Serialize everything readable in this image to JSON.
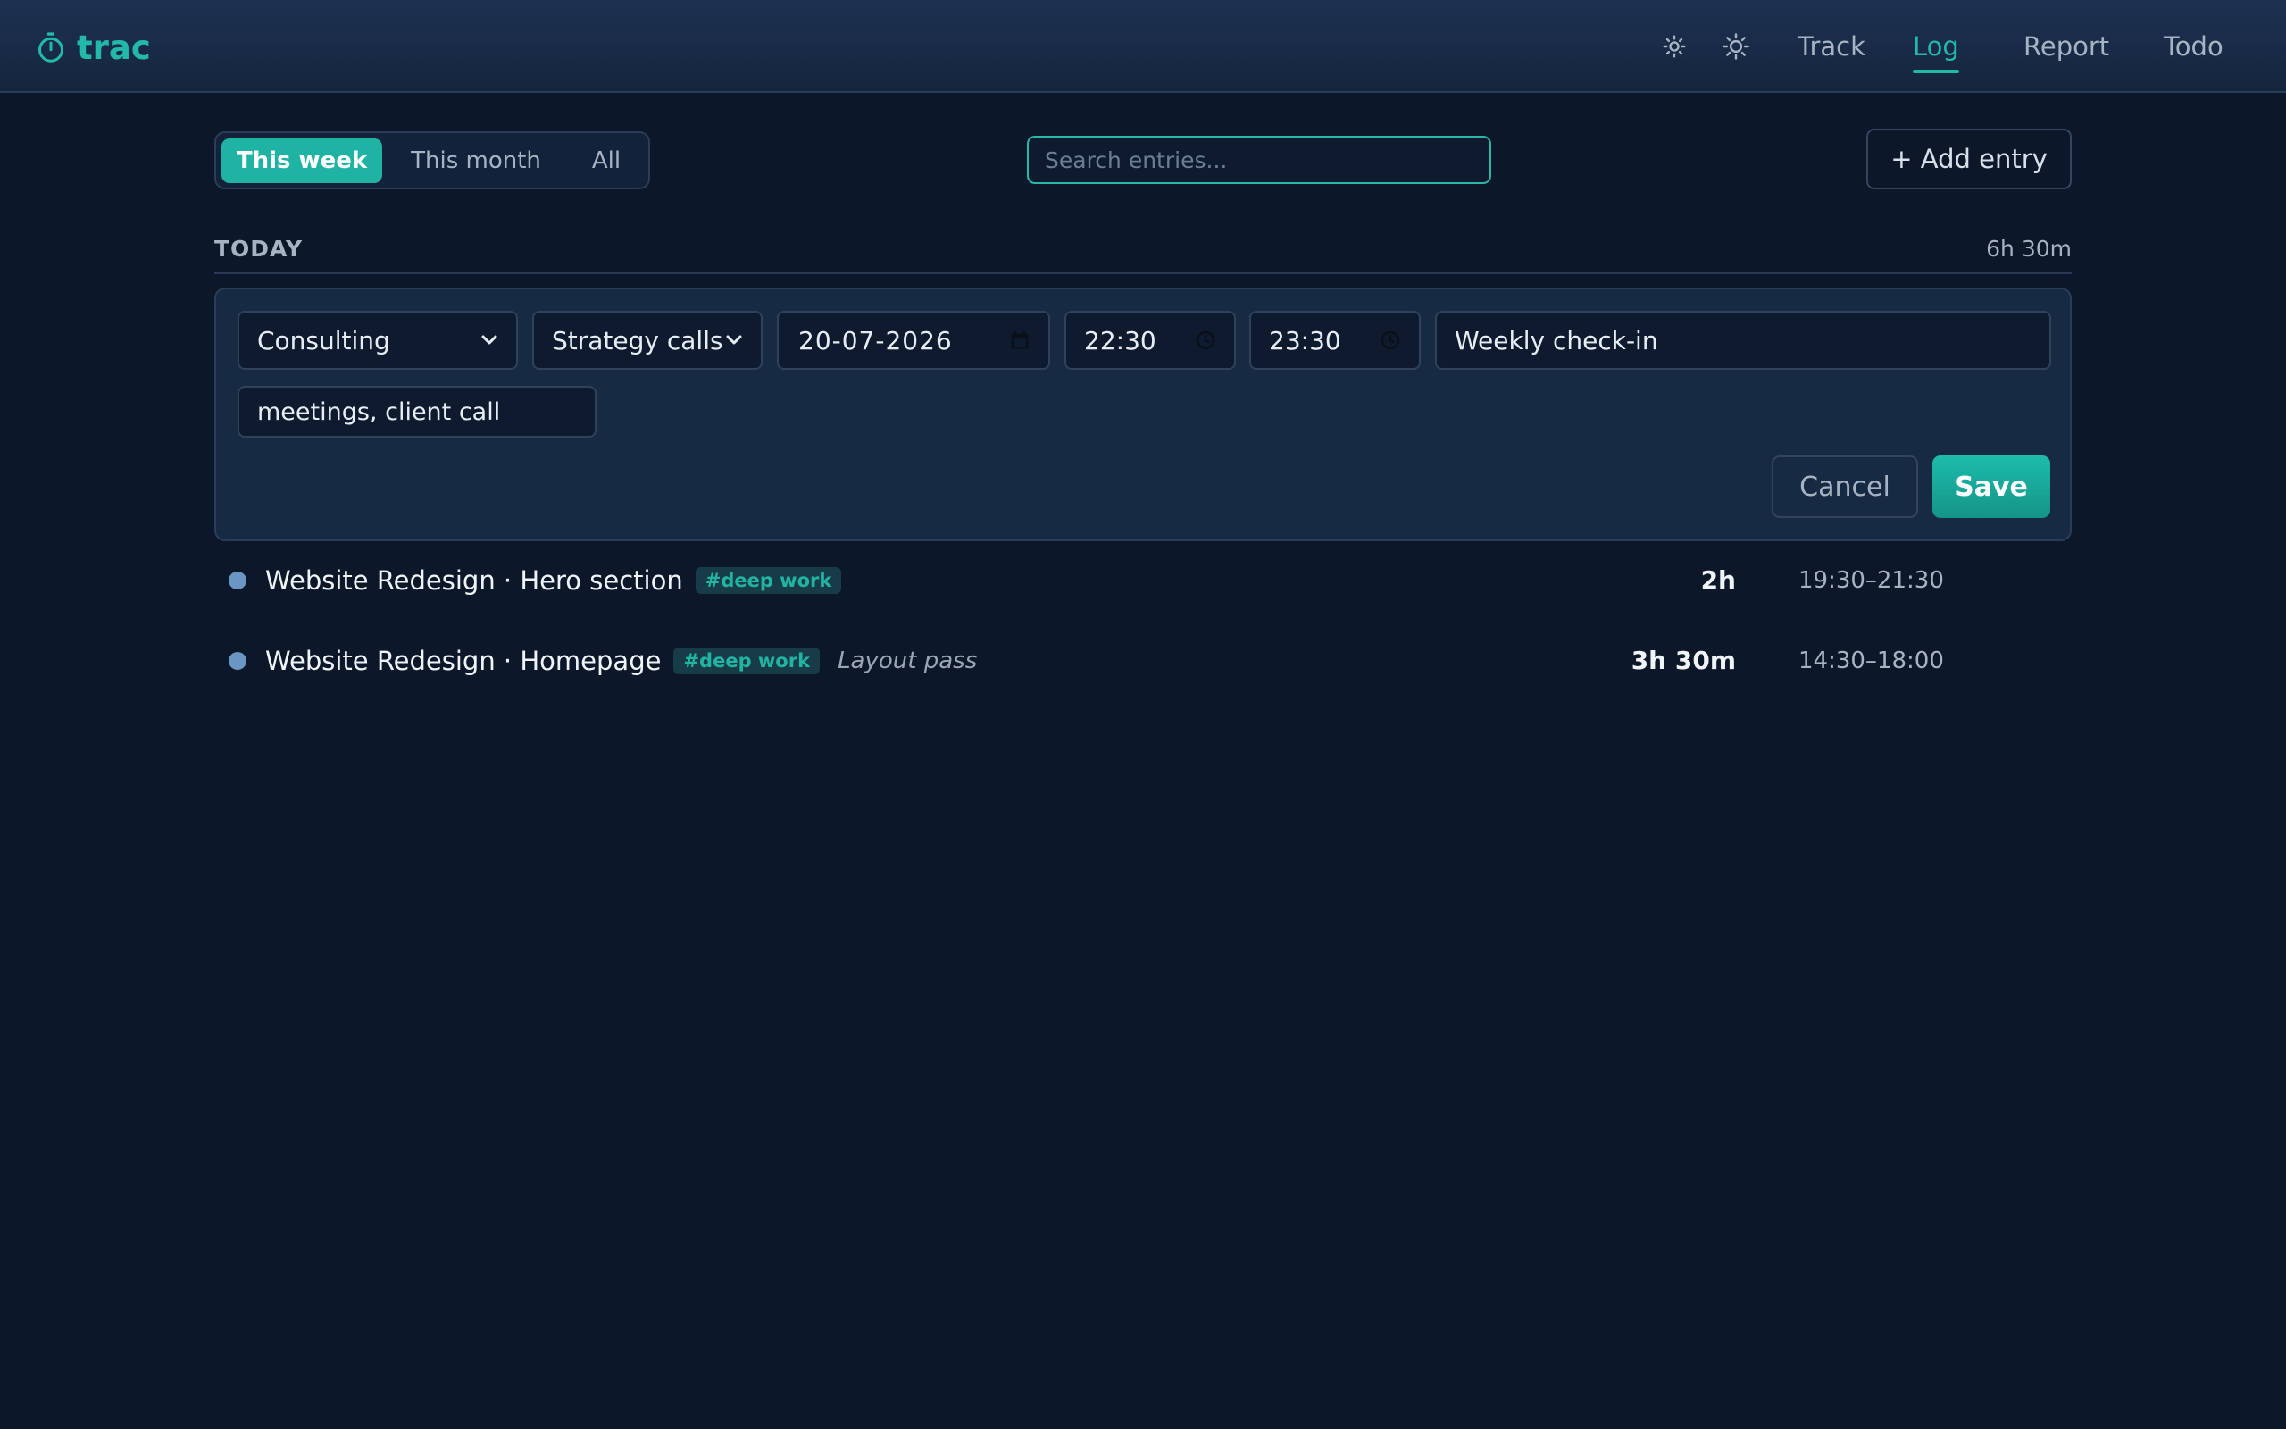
{
  "app": {
    "name": "trac",
    "logo_icon": "stopwatch-icon",
    "accent_color": "#23b8a8"
  },
  "header": {
    "theme_buttons": [
      {
        "icon": "sun-small-icon"
      },
      {
        "icon": "sun-icon"
      }
    ],
    "nav": [
      {
        "label": "Track",
        "active": false
      },
      {
        "label": "Log",
        "active": true
      },
      {
        "label": "Report",
        "active": false
      },
      {
        "label": "Todo",
        "active": false
      }
    ]
  },
  "filters": {
    "periods": [
      {
        "label": "This week",
        "active": true
      },
      {
        "label": "This month",
        "active": false
      },
      {
        "label": "All",
        "active": false
      }
    ],
    "search_placeholder": "Search entries...",
    "search_value": "",
    "add_entry_label": "+ Add entry"
  },
  "day": {
    "label": "TODAY",
    "total": "6h 30m"
  },
  "edit_form": {
    "project": "Consulting",
    "task": "Strategy calls",
    "date": "20-07-2026",
    "start": "22:30",
    "end": "23:30",
    "description": "Weekly check-in",
    "tags": "meetings, client call",
    "cancel_label": "Cancel",
    "save_label": "Save"
  },
  "entries": [
    {
      "title": "Website Redesign · Hero section",
      "tag": "#deep work",
      "note": "",
      "duration": "2h",
      "range": "19:30–21:30",
      "dot_color": "#6b95c2"
    },
    {
      "title": "Website Redesign · Homepage",
      "tag": "#deep work",
      "note": "Layout pass",
      "duration": "3h 30m",
      "range": "14:30–18:00",
      "dot_color": "#6b95c2"
    }
  ]
}
